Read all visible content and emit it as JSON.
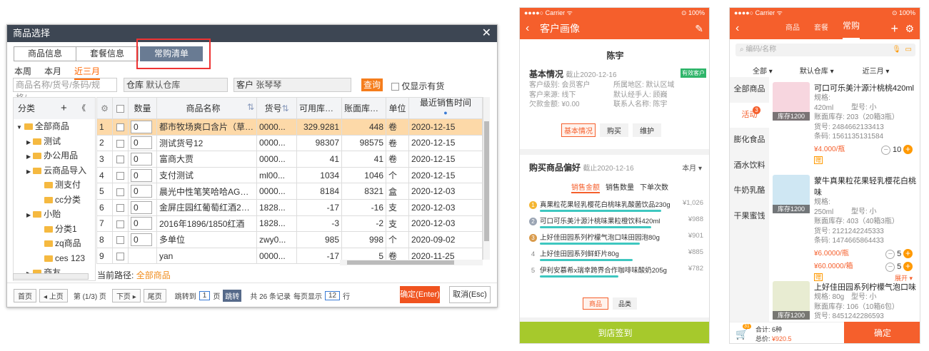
{
  "dialog": {
    "title": "商品选择",
    "close": "✕",
    "tabs": [
      "商品信息",
      "套餐信息",
      "常购清单"
    ],
    "time_tabs": [
      "本周",
      "本月",
      "近三月"
    ],
    "search_placeholder": "商品名称/货号/条码/规格/...",
    "warehouse_label": "仓库",
    "warehouse_value": "默认仓库",
    "customer_label": "客户",
    "customer_value": "张琴琴",
    "query_btn": "查询",
    "only_stock": "仅显示有货",
    "tree_header": "分类",
    "tree_add": "+",
    "tree_collapse": "《",
    "tree": [
      "全部商品",
      "测试",
      "办公用品",
      "云商品导入",
      "测支付",
      "cc分类",
      "小贻",
      "分类1",
      "zq商品",
      "ces 123",
      "商友"
    ],
    "columns": [
      "数量",
      "商品名称",
      "货号",
      "可用库存",
      "账面库存",
      "单位",
      "最近销售时间"
    ],
    "rows": [
      {
        "n": "1",
        "qty": "0",
        "name": "都市牧场爽口含片（草莓...",
        "code": "0000...",
        "avail": "329.9281",
        "book": "448",
        "unit": "卷",
        "date": "2020-12-15"
      },
      {
        "n": "2",
        "qty": "0",
        "name": "测试货号12",
        "code": "0000...",
        "avail": "98307",
        "book": "98575",
        "unit": "卷",
        "date": "2020-12-15"
      },
      {
        "n": "3",
        "qty": "0",
        "name": "富商大贾",
        "code": "0000...",
        "avail": "41",
        "book": "41",
        "unit": "卷",
        "date": "2020-12-15"
      },
      {
        "n": "4",
        "qty": "0",
        "name": "支付测试",
        "code": "ml00...",
        "avail": "1034",
        "book": "1046",
        "unit": "个",
        "date": "2020-12-15"
      },
      {
        "n": "5",
        "qty": "0",
        "name": "晨光中性笔笑哈哈AGP61...",
        "code": "0000...",
        "avail": "8184",
        "book": "8321",
        "unit": "盒",
        "date": "2020-12-03"
      },
      {
        "n": "6",
        "qty": "0",
        "name": "金屏庄园红葡萄红酒2018",
        "code": "1828...",
        "avail": "-17",
        "book": "-16",
        "unit": "支",
        "date": "2020-12-03"
      },
      {
        "n": "7",
        "qty": "0",
        "name": "2016年1896/1850红酒",
        "code": "1828...",
        "avail": "-3",
        "book": "-2",
        "unit": "支",
        "date": "2020-12-03"
      },
      {
        "n": "8",
        "qty": "0",
        "name": "多单位",
        "code": "zwy0...",
        "avail": "985",
        "book": "998",
        "unit": "个",
        "date": "2020-09-02"
      },
      {
        "n": "9",
        "qty": "",
        "name": "yan",
        "code": "0000...",
        "avail": "-17",
        "book": "5",
        "unit": "卷",
        "date": "2020-11-25"
      }
    ],
    "path_label": "当前路径:",
    "path_value": "全部商品",
    "pager": {
      "first": "首页",
      "prev": "上页",
      "page_info": "第 (1/3) 页",
      "next": "下页",
      "last": "尾页",
      "jump": "跳转到",
      "page_input": "1",
      "page_unit": "页",
      "go": "跳转",
      "total": "共 26 条记录",
      "per_page": "每页显示",
      "per_input": "12",
      "per_unit": "行"
    },
    "confirm": "确定(Enter)",
    "cancel": "取消(Esc)"
  },
  "phone2": {
    "carrier": "●●●●○ Carrier ᯤ",
    "battery": "⊙ 100%",
    "title": "客户画像",
    "name": "陈宇",
    "basic_title": "基本情况",
    "basic_date": "截止2020-12-16",
    "badge": "有效客户",
    "fields": [
      [
        "客户级别: 会员客户",
        "所属地区: 默认区域"
      ],
      [
        "客户来源: 线下",
        "默认经手人: 顾巍"
      ],
      [
        "欠款金额: ¥0.00",
        "联系人名称: 陈宇"
      ]
    ],
    "actions": [
      "基本情况",
      "购买",
      "维护"
    ],
    "pref_title": "购买商品偏好",
    "pref_date": "截止2020-12-16",
    "pref_period": "本月",
    "pref_tabs": [
      "销售金额",
      "销售数量",
      "下单次数"
    ],
    "items": [
      {
        "n": "1",
        "name": "真果粒花果轻乳樱花白桃味乳酸菌饮品230g",
        "amt": "¥1,026",
        "bar": 0.85
      },
      {
        "n": "2",
        "name": "可口可乐美汁源汁桃味果粒橙饮料420ml",
        "amt": "¥988",
        "bar": 0.78
      },
      {
        "n": "3",
        "name": "上好佳田园系列柠檬气泡口味田园泡80g",
        "amt": "¥901",
        "bar": 0.7
      },
      {
        "n": "4",
        "name": "上好佳田园系列鲜虾片80g",
        "amt": "¥885",
        "bar": 0.65
      },
      {
        "n": "5",
        "name": "伊利安慕希x瑞幸跨界合作咖啡味酸奶205g",
        "amt": "¥782",
        "bar": 0.55
      }
    ],
    "bottom_tabs": [
      "商品",
      "品类"
    ],
    "checkin": "到店签到"
  },
  "phone3": {
    "carrier": "●●●●○ Carrier ᯤ",
    "battery": "⊙ 100%",
    "tabs": [
      "商品",
      "套餐",
      "常购"
    ],
    "search_placeholder": "编码/名称",
    "filters": [
      "全部",
      "默认仓库",
      "近三月"
    ],
    "side": [
      "全部商品",
      "活动",
      "膨化食品",
      "酒水饮料",
      "牛奶乳酪",
      "干果蜜饯"
    ],
    "side_badge": "3",
    "products": [
      {
        "name": "可口可乐美汁源汁桃桃420ml",
        "spec": "规格: 420ml",
        "model": "型号: 小",
        "book": "账面库存: 203（20箱3瓶）",
        "code": "货号: 2484662133413",
        "bar": "条码: 1561135131584",
        "price": "¥4.000/瓶",
        "qty": "10",
        "stock": "库存1200"
      },
      {
        "name": "蒙牛真果粒花果轻乳樱花白桃味",
        "spec": "规格: 250ml",
        "model": "型号: 小",
        "book": "账面库存: 403（40箱3瓶）",
        "code": "货号: 2121242245333",
        "bar": "条码: 1474665864433",
        "price": "¥6.0000/瓶",
        "price2": "¥60.0000/箱",
        "qty": "5",
        "qty2": "5",
        "stock": "库存1200",
        "expand": "展开"
      },
      {
        "name": "上好佳田园系列柠檬气泡口味",
        "spec": "规格: 80g",
        "model": "型号: 小",
        "book": "账面库存: 106（10箱6包）",
        "code": "货号: 8451242286593",
        "stock": "库存1200"
      }
    ],
    "gift": "赠",
    "cart_badge": "31",
    "total_label": "合计:",
    "total_count": "6种",
    "sum_label": "总价:",
    "sum_value": "¥920.5",
    "confirm": "确定"
  }
}
